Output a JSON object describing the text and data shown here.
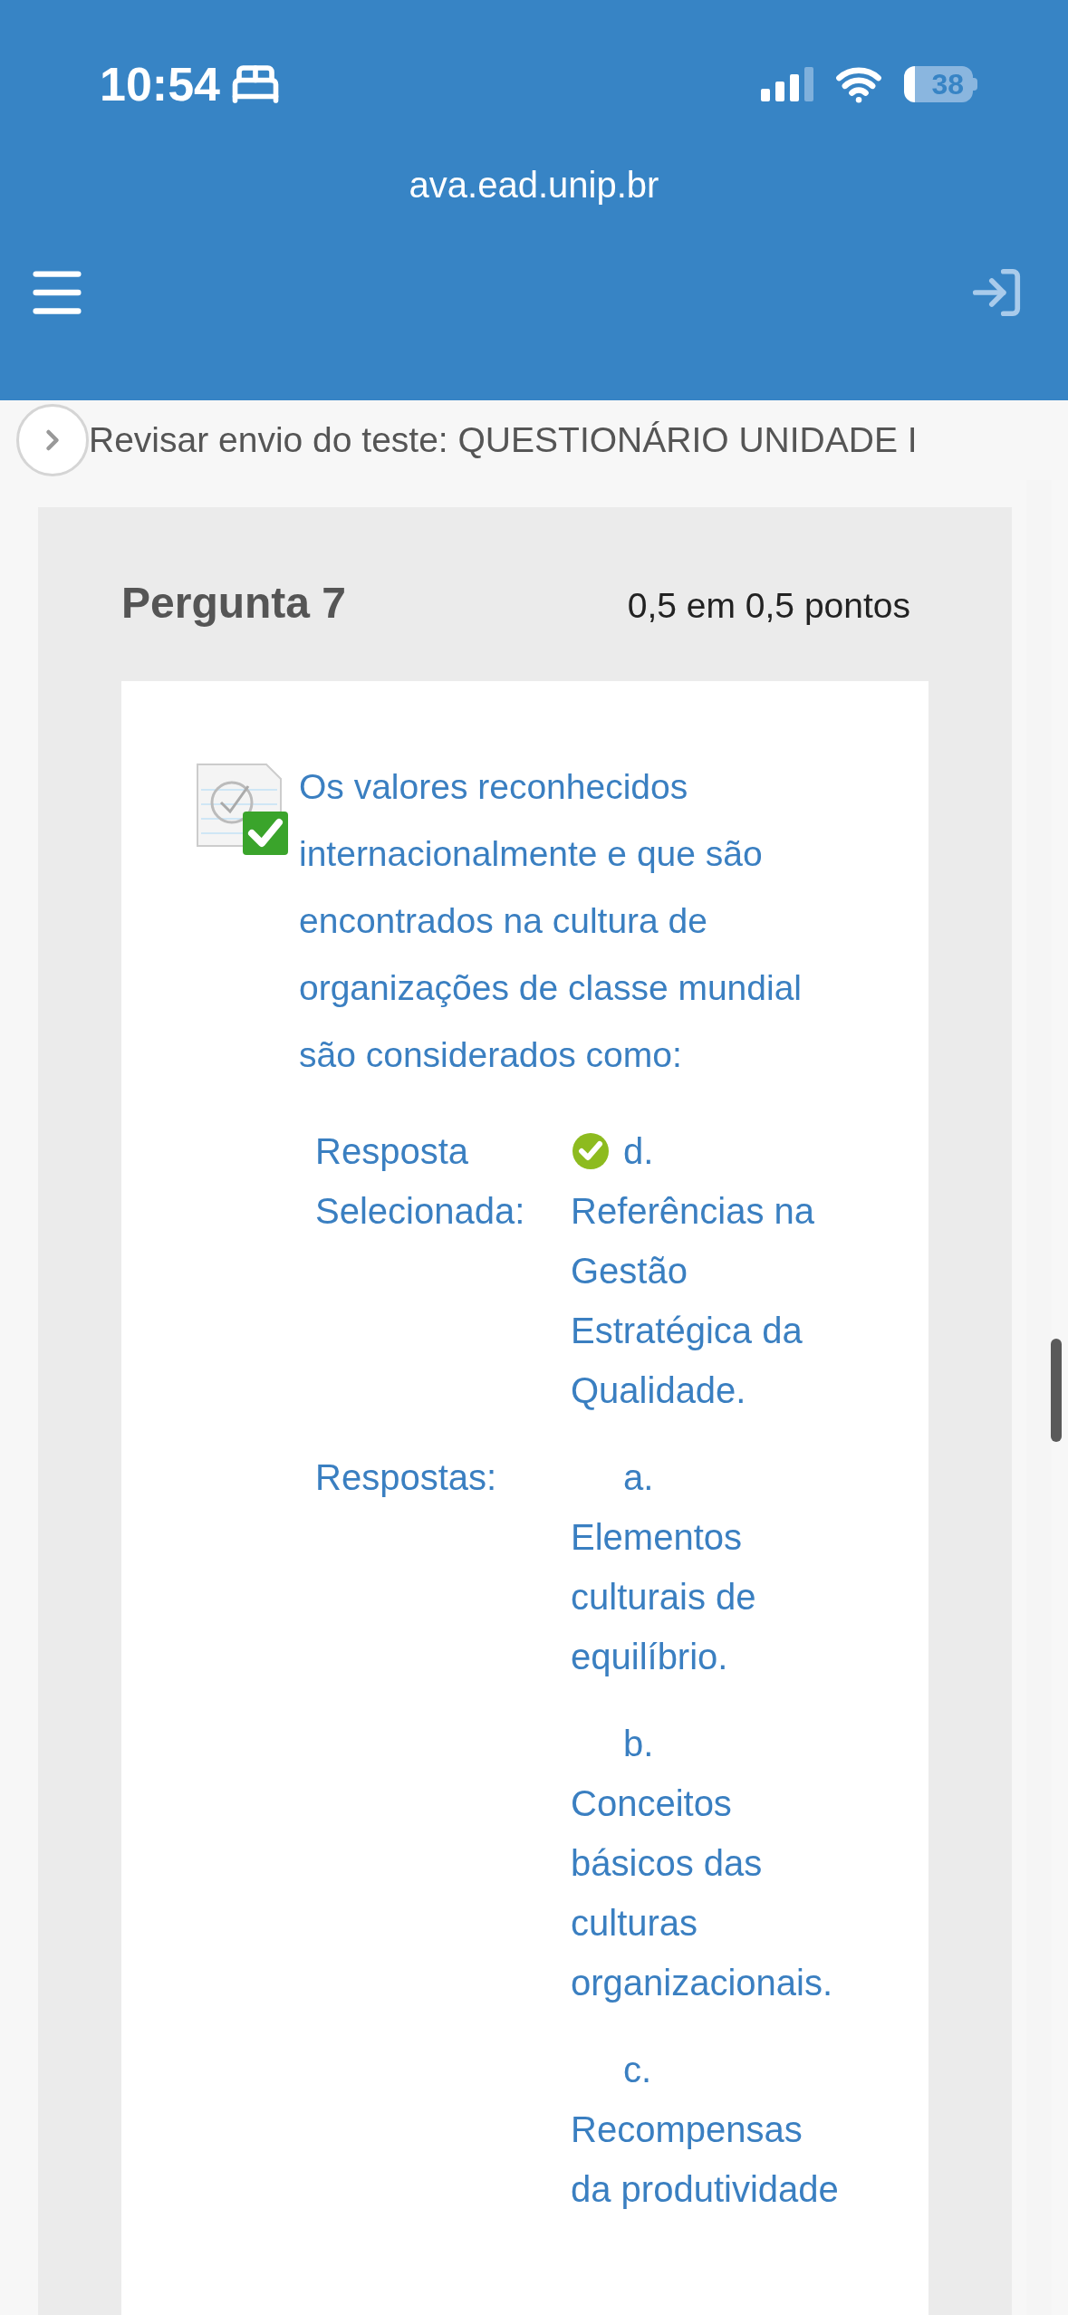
{
  "status_bar": {
    "time": "10:54",
    "battery": "38"
  },
  "url": "ava.ead.unip.br",
  "breadcrumb": "Revisar envio do teste: QUESTIONÁRIO UNIDADE I",
  "question": {
    "title": "Pergunta 7",
    "score": "0,5 em 0,5 pontos",
    "correct": true,
    "text": "Os valores reconhecidos internacionalmente e que são encontrados na cultura de organizações de classe mundial são considerados como:",
    "selected_label": "Resposta Selecionada:",
    "selected_answer": {
      "letter": "d.",
      "text": "Referências na Gestão Estratégica da Qualidade.",
      "correct": true
    },
    "answers_label": "Respostas:",
    "answers": [
      {
        "letter": "a.",
        "text": "Elementos culturais de equilíbrio."
      },
      {
        "letter": "b.",
        "text": "Conceitos básicos das culturas organizacionais."
      },
      {
        "letter": "c.",
        "text": "Recompensas da produtividade"
      }
    ]
  }
}
